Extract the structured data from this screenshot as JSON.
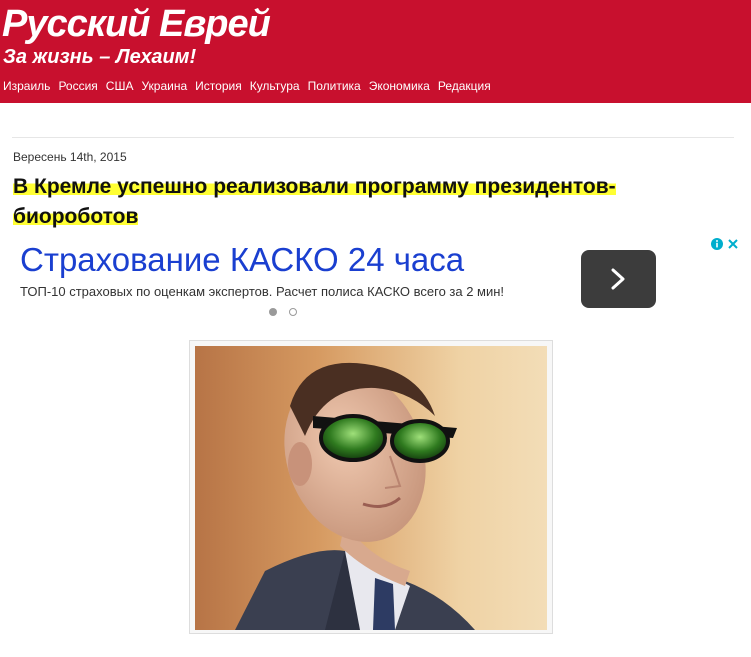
{
  "site": {
    "title": "Русский Еврей",
    "tagline": "За жизнь – Лехаим!"
  },
  "nav": {
    "items": [
      "Израиль",
      "Россия",
      "США",
      "Украина",
      "История",
      "Культура",
      "Политика",
      "Экономика",
      "Редакция"
    ]
  },
  "article": {
    "date": "Вересень 14th, 2015",
    "title": "В Кремле успешно реализовали программу президентов-биороботов",
    "image_icon": "photo-portrait"
  },
  "ad": {
    "title": "Страхование КАСКО 24 часа",
    "description": "ТОП-10 страховых по оценкам экспертов. Расчет полиса КАСКО всего за 2 мин!",
    "arrow_icon": "chevron-right-icon",
    "info_icon": "info-icon",
    "close_icon": "close-icon",
    "colors": {
      "title": "#1a3fd0",
      "button": "#3c3c3c",
      "badge": "#00aecd"
    }
  },
  "colors": {
    "header": "#c8102e",
    "highlight": "#ffff33"
  }
}
